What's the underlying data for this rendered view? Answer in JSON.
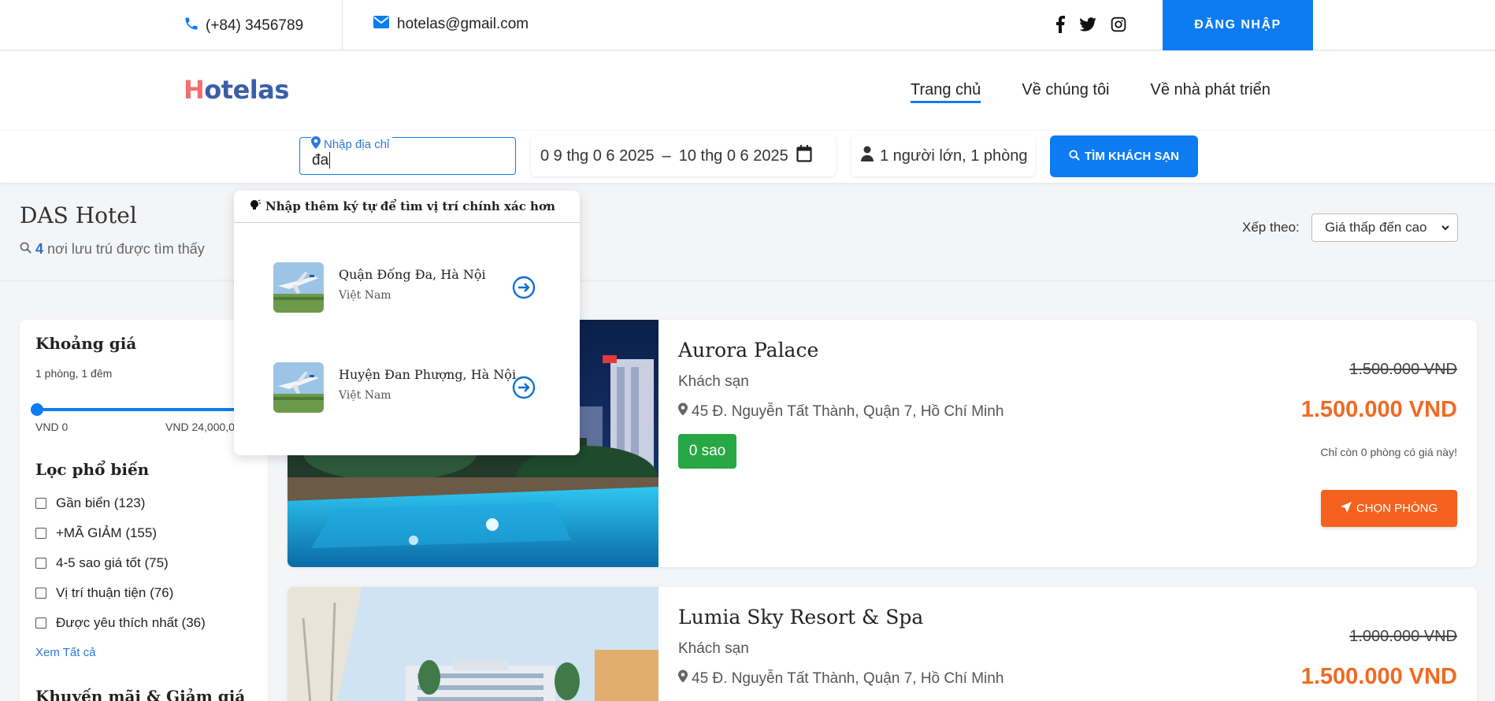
{
  "topbar": {
    "phone": "(+84) 3456789",
    "email": "hotelas@gmail.com",
    "login": "ĐĂNG NHẬP",
    "icons": [
      "phone-icon",
      "mail-icon",
      "facebook-icon",
      "twitter-icon",
      "instagram-icon"
    ]
  },
  "nav": {
    "logo_h": "H",
    "logo_rest": "otelas",
    "links": [
      "Trang chủ",
      "Về chúng tôi",
      "Về nhà phát triển"
    ]
  },
  "search": {
    "address_label": "Nhập địa chỉ",
    "address_value": "đa",
    "checkin": "0 9 thg 0 6  2025",
    "dash": "–",
    "checkout": "10 thg 0 6  2025",
    "guests": "1 người lớn, 1 phòng",
    "button": "TÌM KHÁCH SẠN"
  },
  "results": {
    "title": "DAS Hotel",
    "count": "4",
    "count_suffix": "nơi lưu trú được tìm thấy",
    "sort_label": "Xếp theo:",
    "sort_value": "Giá thấp đến cao"
  },
  "sidebar": {
    "price_title": "Khoảng giá",
    "price_sub": "1 phòng, 1 đêm",
    "price_min": "VND 0",
    "price_max": "VND 24,000,0",
    "popular_title": "Lọc phổ biến",
    "filters": [
      "Gần biển (123)",
      "+MÃ GIẢM (155)",
      "4-5 sao giá tốt (75)",
      "Vị trí thuận tiện (76)",
      "Được yêu thích nhất (36)"
    ],
    "see_all": "Xem Tất cả",
    "promo_title": "Khuyến mãi & Giảm giá"
  },
  "hotels": [
    {
      "name": "Aurora Palace",
      "type": "Khách sạn",
      "address": "45 Đ. Nguyễn Tất Thành, Quận 7, Hồ Chí Minh",
      "stars": "0 sao",
      "old_price": "1.500.000 VND",
      "price": "1.500.000 VND",
      "note": "Chỉ còn 0 phòng có giá này!",
      "button": "CHỌN PHÒNG"
    },
    {
      "name": "Lumia Sky Resort & Spa",
      "type": "Khách sạn",
      "address": "45 Đ. Nguyễn Tất Thành, Quận 7, Hồ Chí Minh",
      "old_price": "1.000.000 VND",
      "price": "1.500.000 VND"
    }
  ],
  "dropdown": {
    "hint": "Nhập thêm ký tự để tìm vị trí chính xác hơn",
    "items": [
      {
        "title": "Quận Đống Đa, Hà Nội",
        "sub": "Việt Nam"
      },
      {
        "title": "Huyện Đan Phượng, Hà Nội",
        "sub": "Việt Nam"
      }
    ]
  },
  "colors": {
    "primary": "#0d7cf2",
    "price": "#f06a22",
    "button_orange": "#f4621d",
    "star_badge": "#28a745",
    "logo_h": "#f36e6e",
    "logo_rest": "#3a5ea8"
  }
}
